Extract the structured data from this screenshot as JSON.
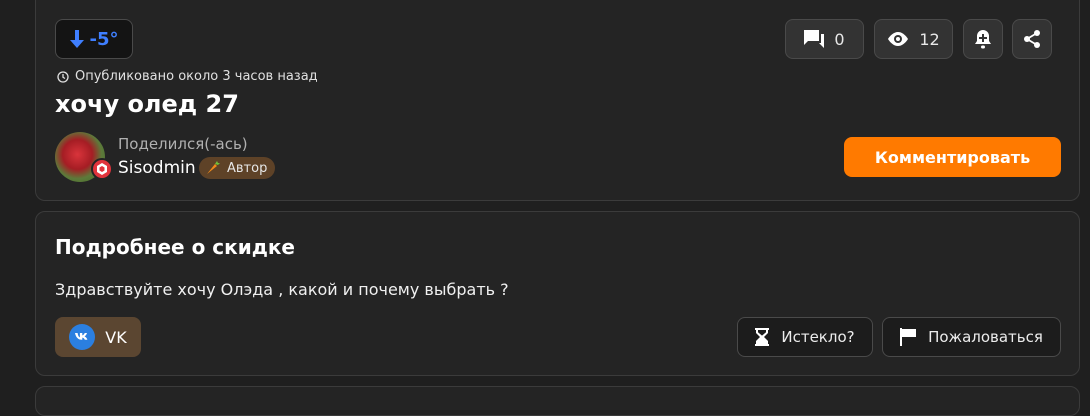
{
  "deal": {
    "temperature": "-5°",
    "comments_count": "0",
    "views_count": "12",
    "published": "Опубликовано около 3 часов назад",
    "title": "хочу олед 27",
    "shared_label": "Поделился(-ась)",
    "username": "Sisodmin",
    "author_badge": "Автор",
    "comment_button": "Комментировать"
  },
  "details": {
    "heading": "Подробнее о скидке",
    "description": "Здравствуйте хочу Олэда , какой и почему выбрать ?",
    "source_tag": "VK",
    "expired_button": "Истекло?",
    "report_button": "Пожаловаться"
  },
  "icons": {
    "temperature": "arrow-down-icon",
    "comments": "comment-icon",
    "views": "eye-icon",
    "subscribe": "bell-plus-icon",
    "share": "share-icon",
    "clock": "clock-icon",
    "author": "carrot-icon",
    "source": "vk-icon",
    "expired": "hourglass-icon",
    "report": "flag-icon"
  },
  "colors": {
    "accent": "#ff7a00",
    "temperature": "#3f7fff",
    "background": "#1f1f1f",
    "card": "#242424"
  }
}
